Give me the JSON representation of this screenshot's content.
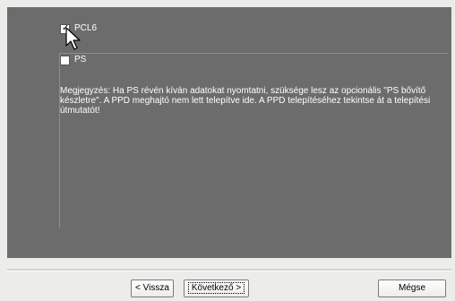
{
  "options": [
    {
      "label": "PCL6",
      "checked": true
    },
    {
      "label": "PS",
      "checked": false
    }
  ],
  "note": "Megjegyzés: Ha PS révén kíván adatokat nyomtatni, szüksége lesz az opcionális \"PS bővítő készletre\". A PPD meghajtó nem lett telepítve ide. A PPD telepítéséhez tekintse át a telepítési útmutatót!",
  "buttons": {
    "back": "< Vissza",
    "next": "Következő >",
    "cancel": "Mégse"
  },
  "colors": {
    "panel": "#6c6c6c",
    "window": "#ececea"
  },
  "icons": {
    "cursor": "arrow-cursor-icon",
    "check": "checkmark-icon"
  }
}
